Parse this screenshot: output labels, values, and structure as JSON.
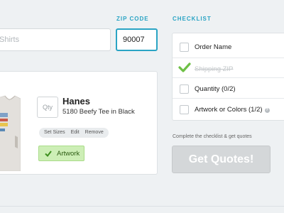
{
  "search": {
    "value": "Shirts"
  },
  "zip": {
    "label": "ZIP CODE",
    "value": "90007"
  },
  "product": {
    "qty_placeholder": "Qty",
    "brand": "Hanes",
    "description": "5180 Beefy Tee in Black",
    "actions": [
      "Set Sizes",
      "Edit",
      "Remove"
    ],
    "badge_label": "Artwork"
  },
  "checklist": {
    "title": "CHECKLIST",
    "items": [
      {
        "label": "Order Name",
        "done": false
      },
      {
        "label": "Shipping ZIP",
        "done": true
      },
      {
        "label": "Quantity (0/2)",
        "done": false
      },
      {
        "label": "Artwork or Colors (1/2)",
        "done": false,
        "help_icon": "?"
      }
    ]
  },
  "quotes": {
    "note": "Complete the checklist & get quotes",
    "button_label": "Get Quotes!"
  },
  "colors": {
    "accent": "#2aa4c4",
    "check_green": "#6ec046",
    "badge_bg": "#cdeeb6",
    "button_disabled": "#d4d7d9",
    "page_bg": "#eef1f3"
  }
}
